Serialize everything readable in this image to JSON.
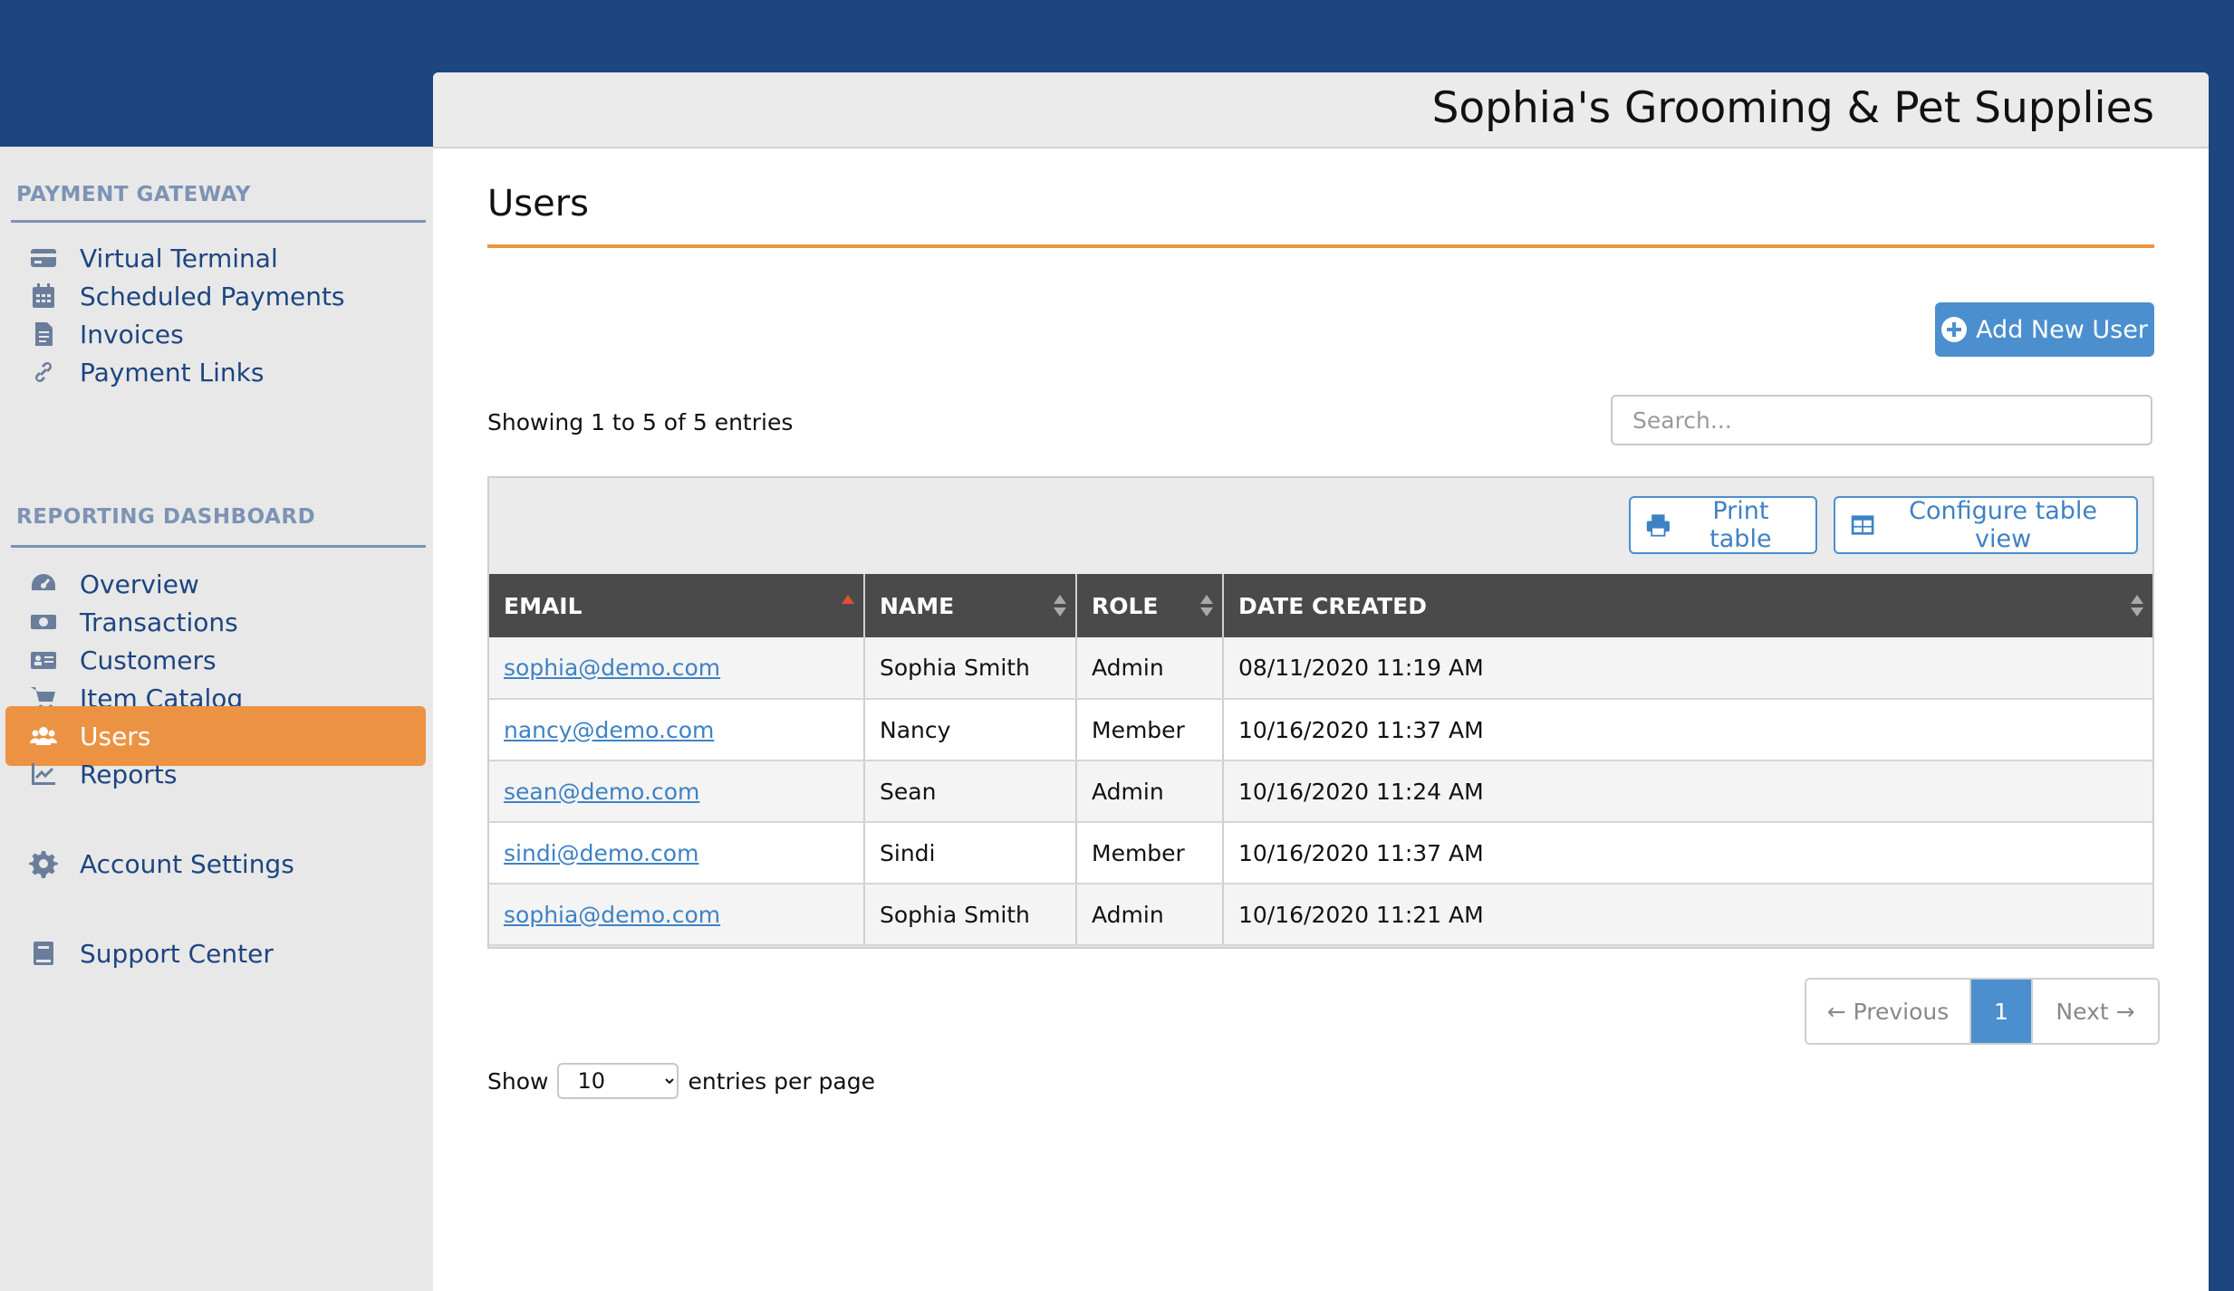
{
  "header": {
    "business_name": "Sophia's Grooming & Pet Supplies"
  },
  "sidebar": {
    "sections": {
      "payment_gateway": "PAYMENT GATEWAY",
      "reporting_dashboard": "REPORTING DASHBOARD"
    },
    "items": [
      {
        "label": "Virtual Terminal",
        "icon": "credit-card-icon"
      },
      {
        "label": "Scheduled Payments",
        "icon": "calendar-icon"
      },
      {
        "label": "Invoices",
        "icon": "invoice-icon"
      },
      {
        "label": "Payment Links",
        "icon": "link-icon"
      },
      {
        "label": "Overview",
        "icon": "dashboard-gauge-icon"
      },
      {
        "label": "Transactions",
        "icon": "money-icon"
      },
      {
        "label": "Customers",
        "icon": "id-card-icon"
      },
      {
        "label": "Item Catalog",
        "icon": "cart-icon"
      },
      {
        "label": "Users",
        "icon": "users-icon",
        "active": true
      },
      {
        "label": "Reports",
        "icon": "chart-line-icon"
      },
      {
        "label": "Account Settings",
        "icon": "gear-icon"
      },
      {
        "label": "Support Center",
        "icon": "book-icon"
      }
    ]
  },
  "main": {
    "title": "Users",
    "add_button": "Add New User",
    "showing": "Showing 1 to 5 of 5 entries",
    "search_placeholder": "Search...",
    "print_button": "Print table",
    "configure_button": "Configure table view",
    "table": {
      "columns": [
        "EMAIL",
        "NAME",
        "ROLE",
        "DATE CREATED"
      ],
      "sorted_column": "EMAIL",
      "sort_direction": "ascending",
      "rows": [
        {
          "email": "sophia@demo.com",
          "name": "Sophia Smith",
          "role": "Admin",
          "date": "08/11/2020 11:19 AM"
        },
        {
          "email": "nancy@demo.com",
          "name": "Nancy",
          "role": "Member",
          "date": "10/16/2020 11:37 AM"
        },
        {
          "email": "sean@demo.com",
          "name": "Sean",
          "role": "Admin",
          "date": "10/16/2020 11:24 AM"
        },
        {
          "email": "sindi@demo.com",
          "name": "Sindi",
          "role": "Member",
          "date": "10/16/2020 11:37 AM"
        },
        {
          "email": "sophia@demo.com",
          "name": "Sophia Smith",
          "role": "Admin",
          "date": "10/16/2020 11:21 AM"
        }
      ]
    },
    "footer": {
      "show_label": "Show",
      "per_page_value": "10",
      "per_page_suffix": "entries per page",
      "prev": "← Previous",
      "current_page": "1",
      "next": "Next →"
    }
  },
  "colors": {
    "brand_blue": "#1d4580",
    "accent_orange": "#ec9343",
    "link_blue": "#3f82c4",
    "button_blue": "#4b8fce"
  }
}
